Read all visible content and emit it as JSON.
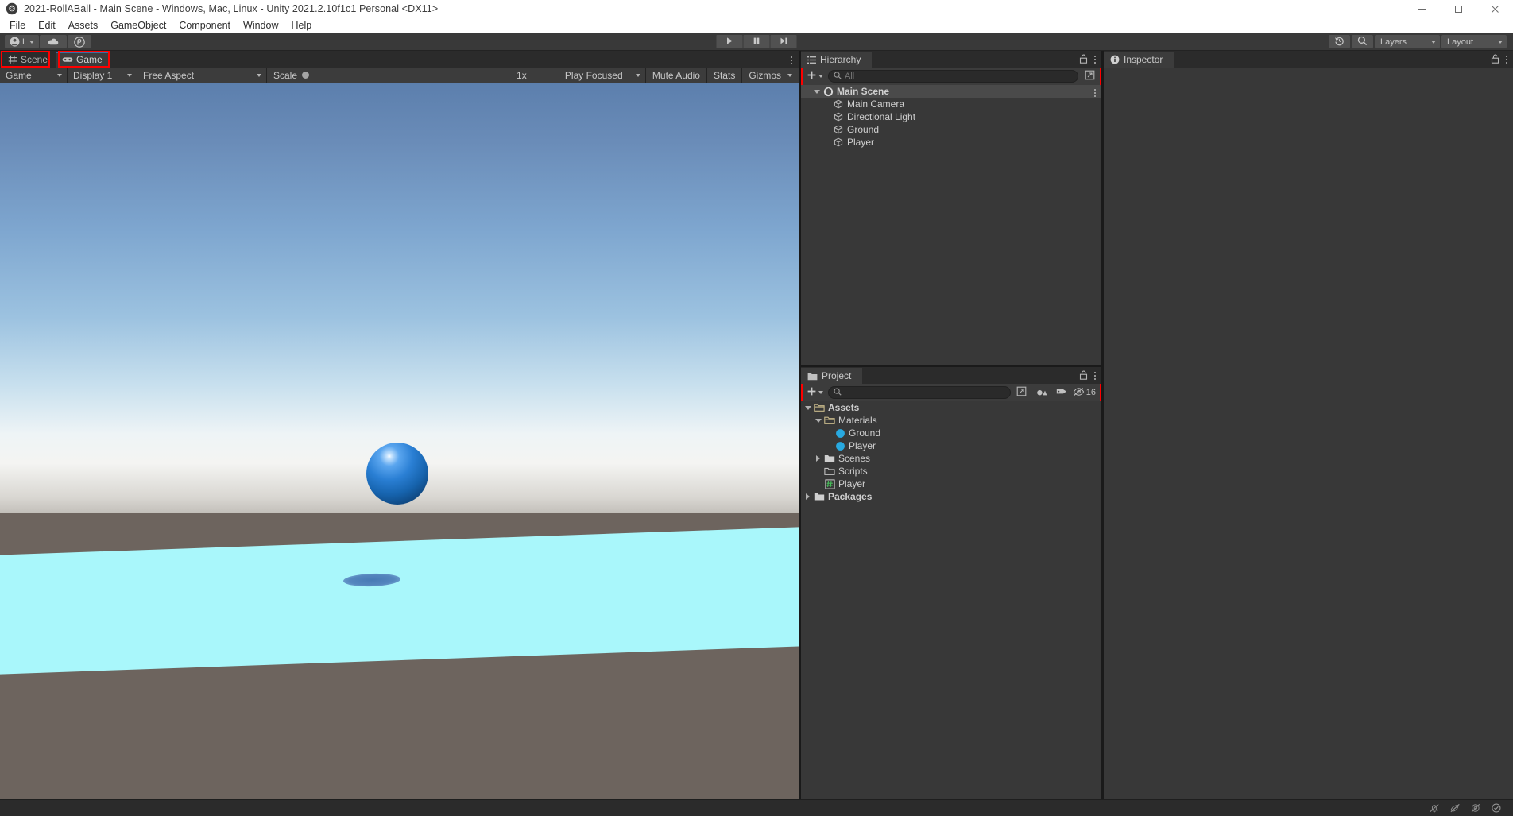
{
  "window": {
    "title": "2021-RollABall - Main Scene - Windows, Mac, Linux - Unity 2021.2.10f1c1 Personal <DX11>",
    "app_icon": "unity-icon",
    "controls": [
      {
        "name": "minimize-button",
        "glyph": "minimize-icon"
      },
      {
        "name": "maximize-button",
        "glyph": "maximize-icon"
      },
      {
        "name": "close-button",
        "glyph": "close-icon"
      }
    ]
  },
  "menubar": {
    "items": [
      {
        "label": "File"
      },
      {
        "label": "Edit"
      },
      {
        "label": "Assets"
      },
      {
        "label": "GameObject"
      },
      {
        "label": "Component"
      },
      {
        "label": "Window"
      },
      {
        "label": "Help"
      }
    ]
  },
  "toolbar": {
    "account_label": "L",
    "account_icon": "account-icon",
    "cloud_icon": "cloud-icon",
    "services_icon": "unity-services-icon",
    "play_icon": "play-icon",
    "pause_icon": "pause-icon",
    "step_icon": "step-icon",
    "history_icon": "undo-history-icon",
    "search_icon": "search-icon",
    "layers_label": "Layers",
    "layout_label": "Layout"
  },
  "view_tabs": {
    "tabs": [
      {
        "label": "Scene",
        "icon": "scene-grid-icon",
        "active": false,
        "highlighted": true
      },
      {
        "label": "Game",
        "icon": "gamepad-icon",
        "active": true,
        "highlighted": true
      }
    ]
  },
  "game_toolbar": {
    "view_mode": "Game",
    "display": "Display 1",
    "aspect": "Free Aspect",
    "scale_label": "Scale",
    "scale_value": "1x",
    "play_mode": "Play Focused",
    "mute_audio": "Mute Audio",
    "stats": "Stats",
    "gizmos": "Gizmos"
  },
  "game_view": {
    "sky_top_color": "#5c7fad",
    "horizon_color": "#f4f4f2",
    "dirt_color": "#6d645e",
    "ground_color": "#a9f7fb",
    "sphere_color": "#1f72c4",
    "shadow_color": "#4d7cb8"
  },
  "hierarchy": {
    "tab_label": "Hierarchy",
    "tab_icon": "hierarchy-icon",
    "lock_icon": "lock-icon",
    "menu_icon": "kebab-icon",
    "add_icon": "plus-icon",
    "search_placeholder": "All",
    "search_value": "",
    "expand_icon": "expand-icon",
    "highlighted": true,
    "items": [
      {
        "label": "Main Scene",
        "icon": "scene-asset-icon",
        "depth": 0,
        "expanded": true,
        "selected": true,
        "bold": true
      },
      {
        "label": "Main Camera",
        "icon": "gameobject-icon",
        "depth": 1,
        "expanded": null,
        "selected": false,
        "bold": false
      },
      {
        "label": "Directional Light",
        "icon": "gameobject-icon",
        "depth": 1,
        "expanded": null,
        "selected": false,
        "bold": false
      },
      {
        "label": "Ground",
        "icon": "gameobject-icon",
        "depth": 1,
        "expanded": null,
        "selected": false,
        "bold": false
      },
      {
        "label": "Player",
        "icon": "gameobject-icon",
        "depth": 1,
        "expanded": null,
        "selected": false,
        "bold": false
      }
    ]
  },
  "project": {
    "tab_label": "Project",
    "tab_icon": "folder-icon",
    "lock_icon": "lock-icon",
    "menu_icon": "kebab-icon",
    "add_icon": "plus-icon",
    "search_placeholder": "",
    "search_value": "",
    "search_in_scene_icon": "search-in-scene-icon",
    "filter_type_icon": "filter-by-type-icon",
    "filter_label_icon": "filter-by-label-icon",
    "hidden_count_icon": "eye-slash-icon",
    "hidden_count": "16",
    "highlighted": true,
    "items": [
      {
        "label": "Assets",
        "icon": "folder-open-icon",
        "depth": 0,
        "expanded": true,
        "bold": true
      },
      {
        "label": "Materials",
        "icon": "folder-open-icon",
        "depth": 1,
        "expanded": true,
        "bold": false
      },
      {
        "label": "Ground",
        "icon": "material-icon",
        "depth": 2,
        "expanded": null,
        "bold": false
      },
      {
        "label": "Player",
        "icon": "material-icon",
        "depth": 2,
        "expanded": null,
        "bold": false
      },
      {
        "label": "Scenes",
        "icon": "folder-icon",
        "depth": 1,
        "expanded": false,
        "bold": false
      },
      {
        "label": "Scripts",
        "icon": "folder-empty-icon",
        "depth": 1,
        "expanded": null,
        "bold": false
      },
      {
        "label": "Player",
        "icon": "csharp-script-icon",
        "depth": 1,
        "expanded": null,
        "bold": false
      },
      {
        "label": "Packages",
        "icon": "folder-icon",
        "depth": 0,
        "expanded": false,
        "bold": true
      }
    ]
  },
  "inspector": {
    "tab_label": "Inspector",
    "tab_icon": "info-icon",
    "lock_icon": "lock-icon",
    "menu_icon": "kebab-icon",
    "highlighted": true,
    "empty": true
  },
  "statusbar": {
    "icons": [
      {
        "name": "mute-notifications-icon"
      },
      {
        "name": "code-optimization-icon"
      },
      {
        "name": "no-preview-icon"
      },
      {
        "name": "checkmark-circle-icon"
      }
    ]
  },
  "highlight": {
    "color": "#ff0000"
  }
}
